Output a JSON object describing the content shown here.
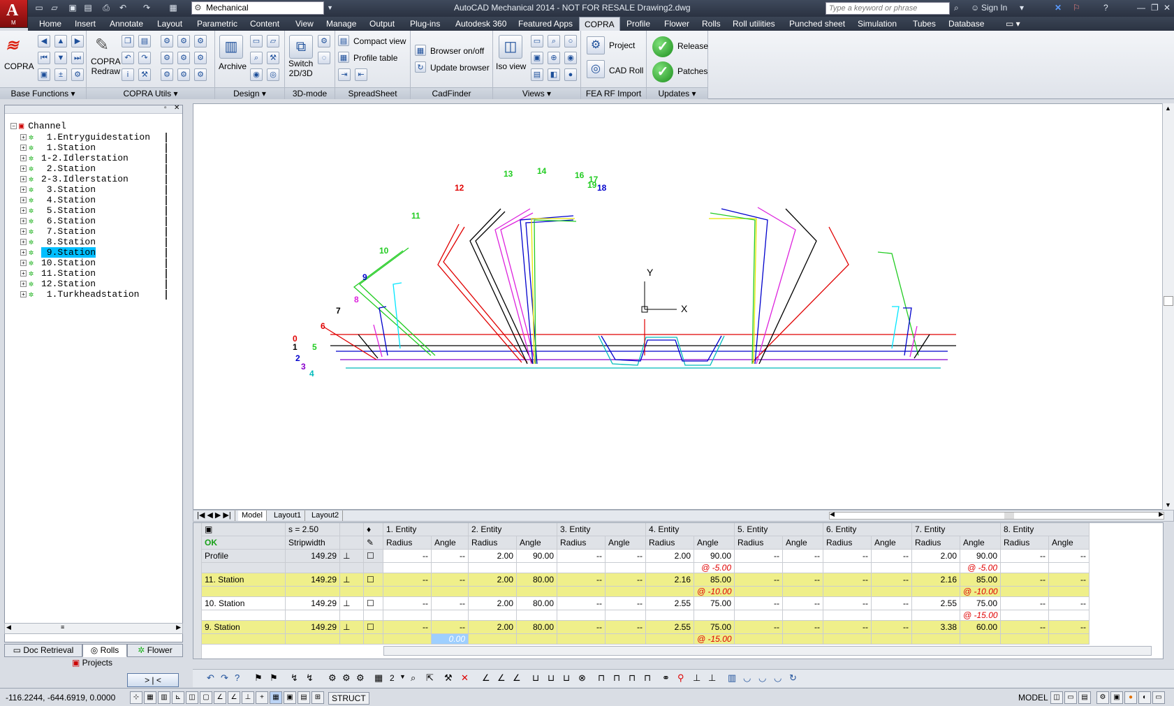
{
  "app": {
    "title": "AutoCAD Mechanical 2014 - NOT FOR RESALE   Drawing2.dwg",
    "logo_letter": "A",
    "logo_sub": "M",
    "workspace": "Mechanical",
    "search_placeholder": "Type a keyword or phrase",
    "sign_in": "Sign In"
  },
  "menu": {
    "tabs": [
      "Home",
      "Insert",
      "Annotate",
      "Layout",
      "Parametric",
      "Content",
      "View",
      "Manage",
      "Output",
      "Plug-ins",
      "Autodesk 360",
      "Featured Apps",
      "COPRA",
      "Profile",
      "Flower",
      "Rolls",
      "Roll utilities",
      "Punched sheet",
      "Simulation",
      "Tubes",
      "Database"
    ],
    "active": "COPRA"
  },
  "ribbon": {
    "panels": [
      "Base Functions",
      "COPRA Utils",
      "Design",
      "3D-mode",
      "SpreadSheet",
      "CadFinder",
      "Views",
      "FEA RF Import",
      "Updates"
    ],
    "copra_label": "COPRA",
    "copra_redraw": "COPRA\nRedraw",
    "archive": "Archive",
    "switch": "Switch\n2D/3D",
    "compact_view": "Compact view",
    "profile_table": "Profile table",
    "browser_onoff": "Browser on/off",
    "update_browser": "Update browser",
    "iso_view": "Iso view",
    "project": "Project",
    "cad_roll": "CAD Roll",
    "release": "Release",
    "patches": "Patches"
  },
  "tree": {
    "root": "Channel",
    "items": [
      {
        "label": " 1.Entryguidestation"
      },
      {
        "label": " 1.Station"
      },
      {
        "label": "1-2.Idlerstation"
      },
      {
        "label": " 2.Station"
      },
      {
        "label": "2-3.Idlerstation"
      },
      {
        "label": " 3.Station"
      },
      {
        "label": " 4.Station"
      },
      {
        "label": " 5.Station"
      },
      {
        "label": " 6.Station"
      },
      {
        "label": " 7.Station"
      },
      {
        "label": " 8.Station"
      },
      {
        "label": " 9.Station"
      },
      {
        "label": "10.Station"
      },
      {
        "label": "11.Station"
      },
      {
        "label": "12.Station"
      },
      {
        "label": " 1.Turkheadstation"
      }
    ],
    "selected_index": 11
  },
  "bottom_tabs": {
    "doc": "Doc Retrieval",
    "rolls": "Rolls",
    "flower": "Flower",
    "projects": "Projects",
    "toggle": "> | <"
  },
  "layout_tabs": [
    "Model",
    "Layout1",
    "Layout2"
  ],
  "drawing": {
    "axis_y": "Y",
    "axis_x": "X",
    "left_labels": [
      "0",
      "1",
      "2",
      "3",
      "4",
      "5",
      "6",
      "7",
      "8",
      "9",
      "10",
      "11",
      "12",
      "13",
      "14",
      "16",
      "17",
      "19",
      "18"
    ]
  },
  "sheet": {
    "s_label": "s = 2.50",
    "ok": "OK",
    "stripwidth": "Stripwidth",
    "entities": [
      "1. Entity",
      "2. Entity",
      "3. Entity",
      "4. Entity",
      "5. Entity",
      "6. Entity",
      "7. Entity",
      "8. Entity"
    ],
    "sub": [
      "Radius",
      "Angle"
    ],
    "rows": [
      {
        "name": "Profile",
        "sw": "149.29",
        "vals": [
          "--",
          "--",
          "2.00",
          "90.00",
          "--",
          "--",
          "2.00",
          "90.00",
          "--",
          "--",
          "--",
          "--",
          "2.00",
          "90.00",
          "--",
          "--"
        ],
        "notes": [
          "",
          "",
          "",
          "",
          "",
          "",
          "",
          "@ -5.00",
          "",
          "",
          "",
          "",
          "",
          "@ -5.00",
          "",
          ""
        ],
        "bg": "hdr"
      },
      {
        "name": "11. Station",
        "sw": "149.29",
        "vals": [
          "--",
          "--",
          "2.00",
          "80.00",
          "--",
          "--",
          "2.16",
          "85.00",
          "--",
          "--",
          "--",
          "--",
          "2.16",
          "85.00",
          "--",
          "--"
        ],
        "notes": [
          "",
          "",
          "",
          "",
          "",
          "",
          "",
          "@ -10.00",
          "",
          "",
          "",
          "",
          "",
          "@ -10.00",
          "",
          ""
        ],
        "bg": "ylw"
      },
      {
        "name": "10. Station",
        "sw": "149.29",
        "vals": [
          "--",
          "--",
          "2.00",
          "80.00",
          "--",
          "--",
          "2.55",
          "75.00",
          "--",
          "--",
          "--",
          "--",
          "2.55",
          "75.00",
          "--",
          "--"
        ],
        "notes": [
          "",
          "",
          "",
          "",
          "",
          "",
          "",
          "",
          "",
          "",
          "",
          "",
          "",
          "@ -15.00",
          "",
          ""
        ],
        "bg": "wht"
      },
      {
        "name": "9. Station",
        "sw": "149.29",
        "vals": [
          "--",
          "--",
          "2.00",
          "80.00",
          "--",
          "--",
          "2.55",
          "75.00",
          "--",
          "--",
          "--",
          "--",
          "3.38",
          "60.00",
          "--",
          "--"
        ],
        "notes": [
          "",
          "0.00",
          "",
          "",
          "",
          "",
          "",
          "@ -15.00",
          "",
          "",
          "",
          "",
          "",
          "",
          "",
          ""
        ],
        "bg": "ylw"
      }
    ]
  },
  "status": {
    "coords": "-116.2244, -644.6919, 0.0000",
    "struct": "STRUCT",
    "model": "MODEL",
    "iso_count": "2"
  }
}
